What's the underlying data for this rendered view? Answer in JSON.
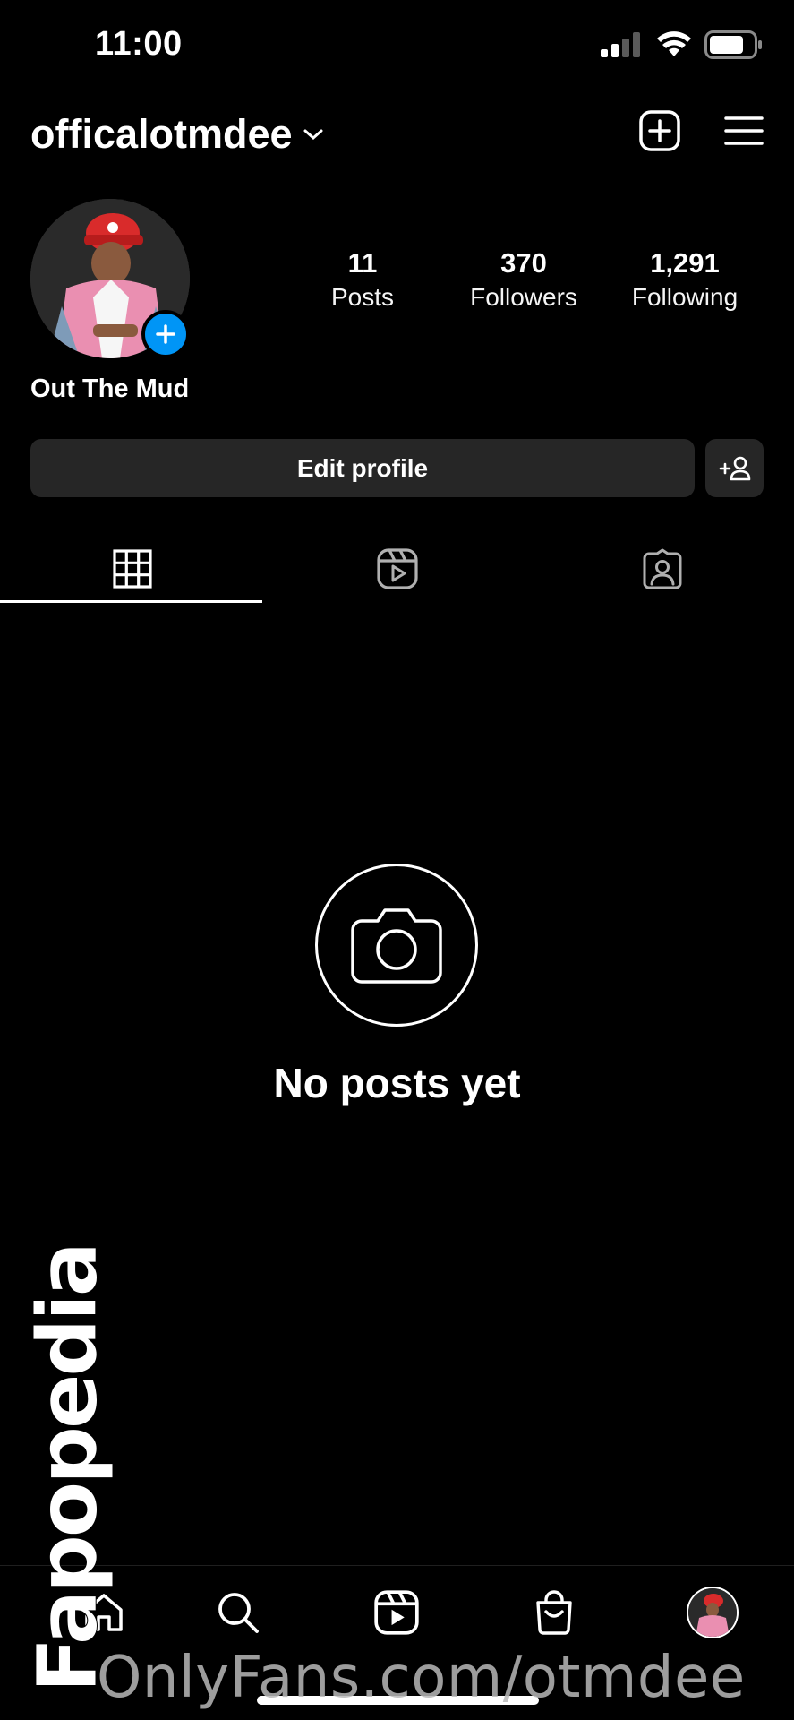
{
  "status_bar": {
    "time": "11:00"
  },
  "header": {
    "username": "officalotmdee",
    "icons": [
      "chevron-down-icon",
      "add-post-icon",
      "menu-icon"
    ]
  },
  "profile": {
    "display_name": "Out The Mud",
    "stats": [
      {
        "value": "11",
        "label": "Posts"
      },
      {
        "value": "370",
        "label": "Followers"
      },
      {
        "value": "1,291",
        "label": "Following"
      }
    ],
    "edit_button_label": "Edit profile"
  },
  "tabs": [
    {
      "name": "grid-icon",
      "active": true
    },
    {
      "name": "reels-icon",
      "active": false
    },
    {
      "name": "tagged-icon",
      "active": false
    }
  ],
  "empty_state": {
    "text": "No posts yet"
  },
  "bottom_nav": [
    "home-icon",
    "search-icon",
    "reels-icon",
    "shop-icon",
    "profile-avatar"
  ],
  "watermarks": {
    "url": "OnlyFans.com/otmdee",
    "side": "Fapopedia"
  },
  "colors": {
    "background": "#000000",
    "button": "#262626",
    "accent": "#0095f6"
  }
}
